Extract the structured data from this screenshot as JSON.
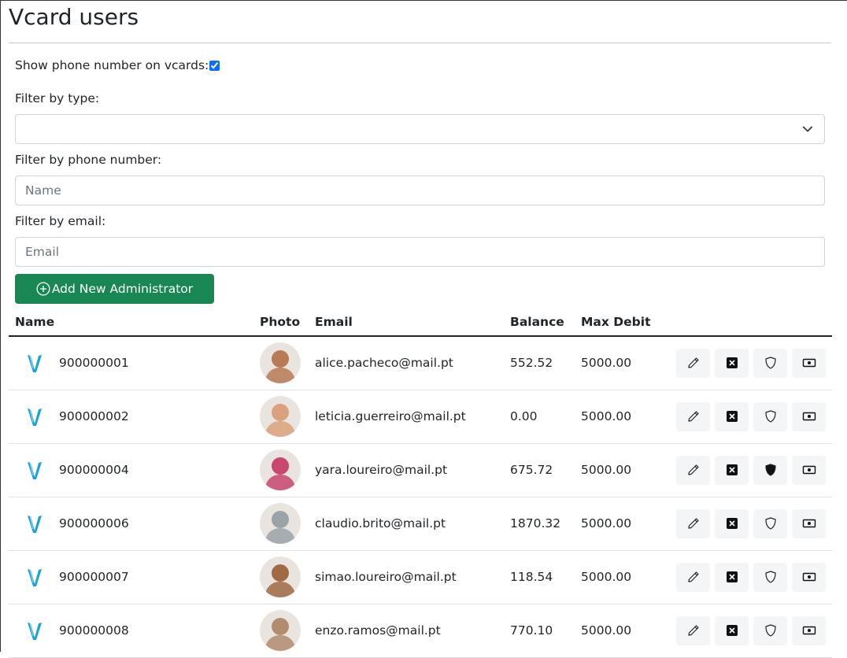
{
  "page": {
    "title": "Vcard users"
  },
  "filters": {
    "show_phone_label": "Show phone number on vcards:",
    "show_phone_checked": true,
    "type_label": "Filter by type:",
    "type_value": "",
    "phone_label": "Filter by phone number:",
    "phone_placeholder": "Name",
    "email_label": "Filter by email:",
    "email_placeholder": "Email"
  },
  "add_button": {
    "label": "Add New Administrator",
    "icon": "plus-circle-icon"
  },
  "table": {
    "headers": {
      "name": "Name",
      "photo": "Photo",
      "email": "Email",
      "balance": "Balance",
      "max_debit": "Max Debit"
    },
    "rows": [
      {
        "name": "900000001",
        "email": "alice.pacheco@mail.pt",
        "balance": "552.52",
        "max_debit": "5000.00",
        "blocked": false,
        "admin": false,
        "avatar_color": "#b77a55"
      },
      {
        "name": "900000002",
        "email": "leticia.guerreiro@mail.pt",
        "balance": "0.00",
        "max_debit": "5000.00",
        "blocked": false,
        "admin": false,
        "avatar_color": "#d9a27c"
      },
      {
        "name": "900000004",
        "email": "yara.loureiro@mail.pt",
        "balance": "675.72",
        "max_debit": "5000.00",
        "blocked": false,
        "admin": true,
        "avatar_color": "#c9466f"
      },
      {
        "name": "900000006",
        "email": "claudio.brito@mail.pt",
        "balance": "1870.32",
        "max_debit": "5000.00",
        "blocked": false,
        "admin": false,
        "avatar_color": "#9aa3a8"
      },
      {
        "name": "900000007",
        "email": "simao.loureiro@mail.pt",
        "balance": "118.54",
        "max_debit": "5000.00",
        "blocked": false,
        "admin": false,
        "avatar_color": "#a06a44"
      },
      {
        "name": "900000008",
        "email": "enzo.ramos@mail.pt",
        "balance": "770.10",
        "max_debit": "5000.00",
        "blocked": false,
        "admin": false,
        "avatar_color": "#b38c70"
      }
    ]
  },
  "icons": {
    "row_logo": "vcard-logo-icon",
    "edit": "pencil-icon",
    "block": "x-square-icon",
    "admin": "shield-icon",
    "balance": "cash-icon"
  },
  "colors": {
    "primary_green": "#198754",
    "logo_blue": "#1ba3d6",
    "checkbox_blue": "#0d6efd"
  }
}
